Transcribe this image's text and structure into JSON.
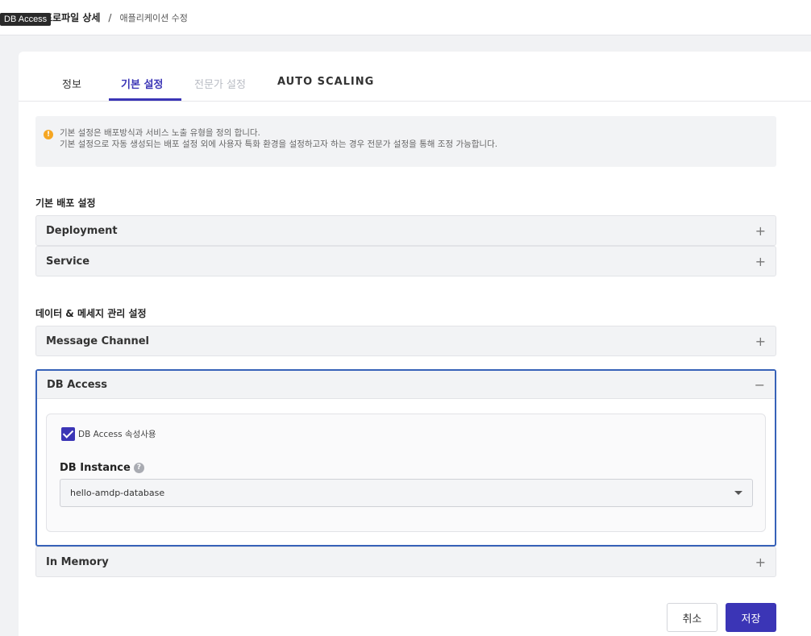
{
  "tooltip": "DB Access",
  "breadcrumb": {
    "current": "프로파일 상세",
    "separator": "/",
    "page": "애플리케이션 수정"
  },
  "tabs": [
    {
      "label": "정보"
    },
    {
      "label": "기본 설정"
    },
    {
      "label": "전문가 설정"
    },
    {
      "label": "AUTO SCALING"
    }
  ],
  "notice": {
    "icon": "!",
    "line1": "기본 설정은 배포방식과 서비스 노출 유형을 정의 합니다.",
    "line2": "기본 설정으로 자동 생성되는 배포 설정 외에 사용자 특화 환경을 설정하고자 하는 경우 전문가 설정을 통해 조정 가능합니다."
  },
  "sections": {
    "deploy_title": "기본 배포 설정",
    "data_title": "데이터 & 메세지 관리 설정"
  },
  "accordions": {
    "deployment": {
      "title": "Deployment",
      "toggle": "+"
    },
    "service": {
      "title": "Service",
      "toggle": "+"
    },
    "message_channel": {
      "title": "Message Channel",
      "toggle": "+"
    },
    "db_access": {
      "title": "DB Access",
      "toggle": "−"
    },
    "in_memory": {
      "title": "In Memory",
      "toggle": "+"
    }
  },
  "db_access_panel": {
    "checkbox_label": "DB Access 속성사용",
    "checked": true,
    "field_label": "DB Instance",
    "help": "?",
    "selected_value": "hello-amdp-database"
  },
  "buttons": {
    "cancel": "취소",
    "save": "저장"
  },
  "colors": {
    "accent": "#3b35b6",
    "open_border": "#3762b8",
    "warning": "#f5a623"
  }
}
